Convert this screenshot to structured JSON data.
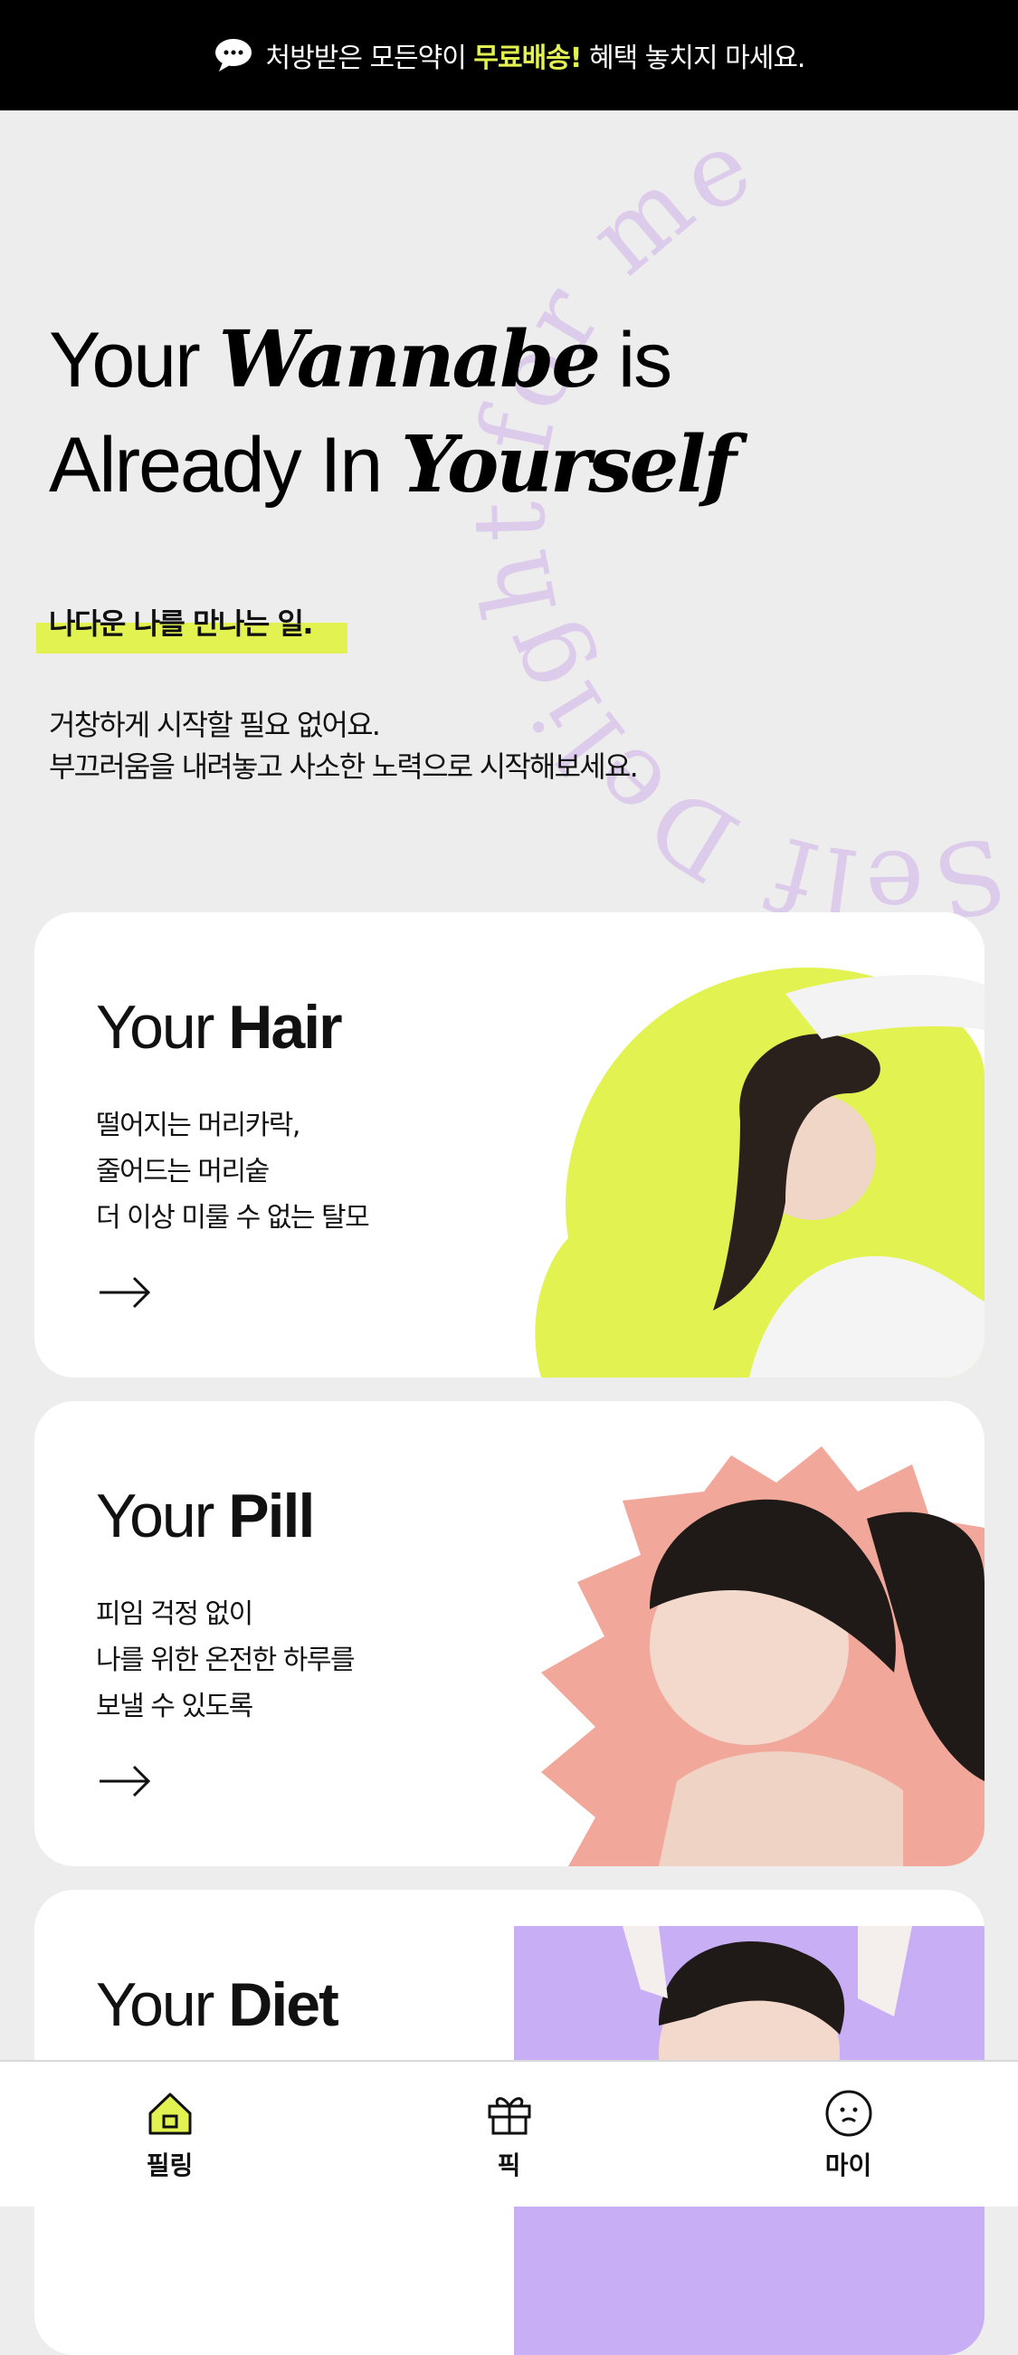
{
  "banner": {
    "text_before": "처방받은 모든약이",
    "highlight": "무료배송!",
    "text_after": "혜택 놓치지 마세요."
  },
  "decorative_curve_text": "Self Delight for me",
  "hero": {
    "line1_a": "Your ",
    "line1_b": "Wannabe",
    "line1_c": " is",
    "line2_a": "Already In ",
    "line2_b": "Yourself"
  },
  "sub": {
    "title": "나다운 나를 만나는 일.",
    "desc_line1": "거창하게 시작할 필요 없어요.",
    "desc_line2": "부끄러움을 내려놓고 사소한 노력으로 시작해보세요."
  },
  "cards": [
    {
      "title_prefix": "Your ",
      "title_bold": "Hair",
      "desc": "떨어지는 머리카락,\n줄어드는 머리숱\n더 이상 미룰 수 없는 탈모",
      "accent": "#e2f250"
    },
    {
      "title_prefix": "Your ",
      "title_bold": "Pill",
      "desc": "피임 걱정 없이\n나를 위한 온전한 하루를\n보낼 수 있도록",
      "accent": "#f1a79a"
    },
    {
      "title_prefix": "Your ",
      "title_bold": "Diet",
      "desc": "",
      "accent": "#c8aef4"
    }
  ],
  "tabbar": [
    {
      "label": "필링",
      "icon": "home-icon",
      "active": true
    },
    {
      "label": "픽",
      "icon": "gift-icon",
      "active": false
    },
    {
      "label": "마이",
      "icon": "face-icon",
      "active": false
    }
  ],
  "colors": {
    "accent": "#e2f250",
    "background": "#ededed",
    "deco_text": "#d9c6e8"
  }
}
